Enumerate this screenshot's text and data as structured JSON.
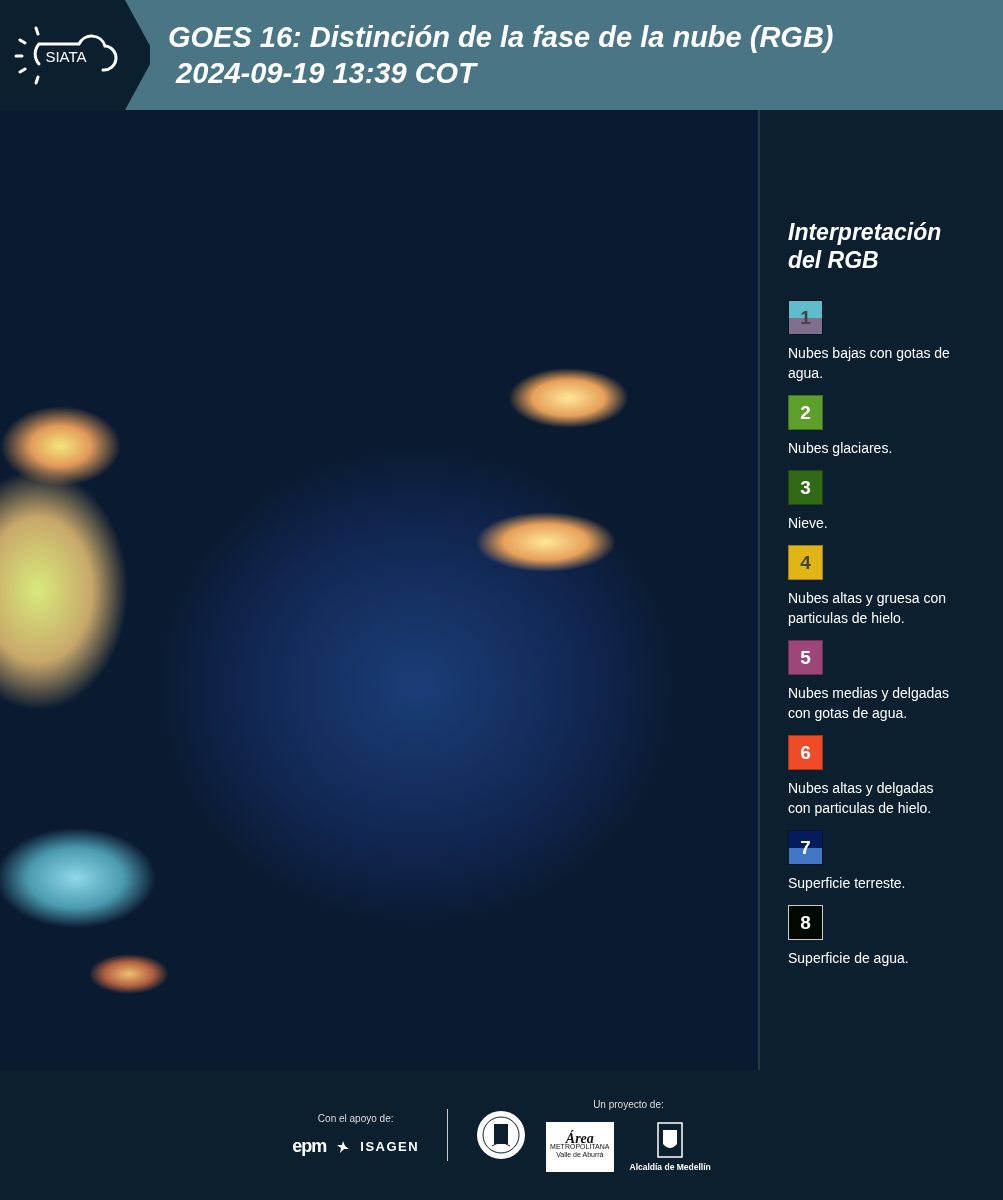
{
  "header": {
    "logo_text": "SIATA",
    "title": "GOES 16: Distinción de la fase de la nube (RGB)",
    "timestamp": "2024-09-19 13:39 COT"
  },
  "legend": {
    "title": "Interpretación del RGB",
    "items": [
      {
        "number": "1",
        "description": "Nubes bajas con gotas de agua.",
        "bands": [
          {
            "color": "#5fbccb"
          },
          {
            "color": "#7f7090"
          }
        ]
      },
      {
        "number": "2",
        "description": "Nubes glaciares.",
        "color": "#5e9e2a"
      },
      {
        "number": "3",
        "description": "Nieve.",
        "color": "#316815"
      },
      {
        "number": "4",
        "description": "Nubes altas y gruesa con particulas de hielo.",
        "color": "#e2b517"
      },
      {
        "number": "5",
        "description": "Nubes medias y delgadas con gotas de agua.",
        "color": "#9d4679"
      },
      {
        "number": "6",
        "description": "Nubes altas y delgadas con particulas de hielo.",
        "color": "#ee4b27"
      },
      {
        "number": "7",
        "description": "Superficie terreste.",
        "bands": [
          {
            "color": "#041c5e"
          },
          {
            "color": "#4476c8"
          }
        ]
      },
      {
        "number": "8",
        "description": "Superficie de agua.",
        "color": "#000800"
      }
    ]
  },
  "footer": {
    "support_label": "Con el apoyo de:",
    "support_logos": [
      "epm",
      "ISAGEN"
    ],
    "project_label": "Un proyecto de:",
    "area_logo": {
      "title": "Área",
      "lines": [
        "METROPOLITANA",
        "Valle de Aburrá"
      ]
    },
    "city_logo_text": "Alcaldía de Medellín"
  }
}
